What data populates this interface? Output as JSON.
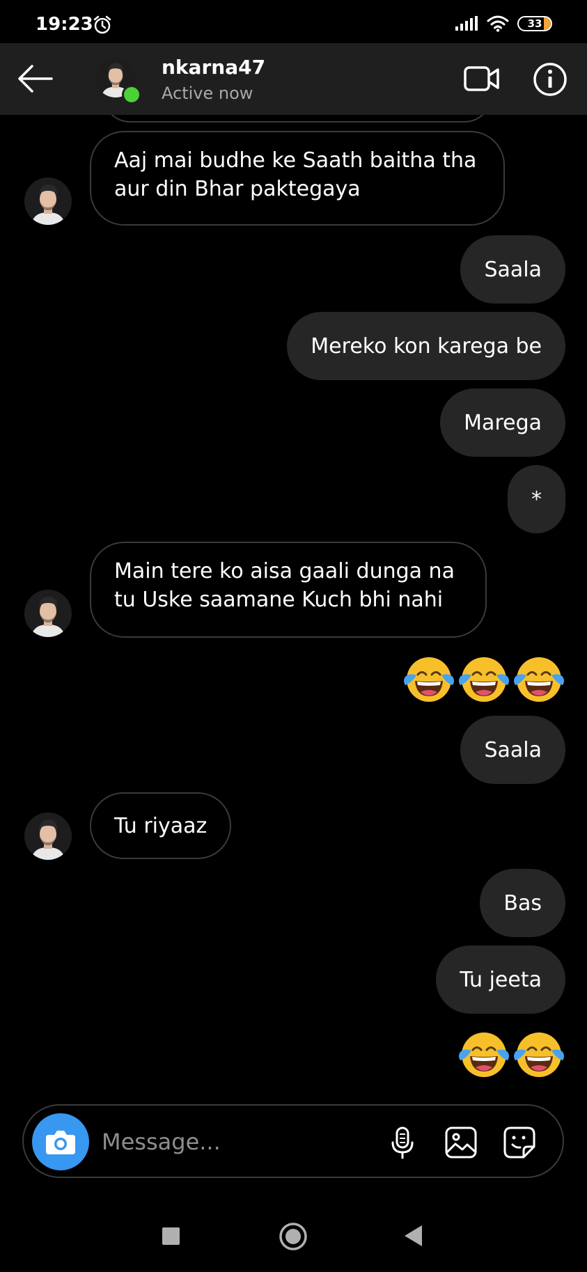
{
  "status_bar": {
    "time": "19:23",
    "battery": "33",
    "icons": [
      "alarm-icon",
      "signal-icon",
      "wifi-icon",
      "battery-icon"
    ]
  },
  "header": {
    "username": "nkarna47",
    "status": "Active now"
  },
  "messages": [
    {
      "from": "them",
      "text": "Aaj mai budhe ke Saath baitha tha aur din Bhar paktegaya"
    },
    {
      "from": "me",
      "text": "Saala"
    },
    {
      "from": "me",
      "text": "Mereko kon karega be"
    },
    {
      "from": "me",
      "text": "Marega"
    },
    {
      "from": "me",
      "text": "*"
    },
    {
      "from": "them",
      "text": "Main tere ko aisa gaali dunga na tu Uske saamane Kuch bhi  nahi"
    },
    {
      "from": "me",
      "emoji": "face-with-tears-of-joy",
      "count": 3
    },
    {
      "from": "me",
      "text": "Saala"
    },
    {
      "from": "them",
      "text": "Tu riyaaz"
    },
    {
      "from": "me",
      "text": "Bas"
    },
    {
      "from": "me",
      "text": "Tu jeeta"
    },
    {
      "from": "me",
      "emoji": "face-with-tears-of-joy",
      "count": 2
    }
  ],
  "composer": {
    "placeholder": "Message..."
  },
  "colors": {
    "background": "#000000",
    "header": "#1f1f1f",
    "sent_bubble": "#262626",
    "received_border": "#3a3a3a",
    "camera_button": "#3897f0",
    "online": "#4cd137"
  }
}
